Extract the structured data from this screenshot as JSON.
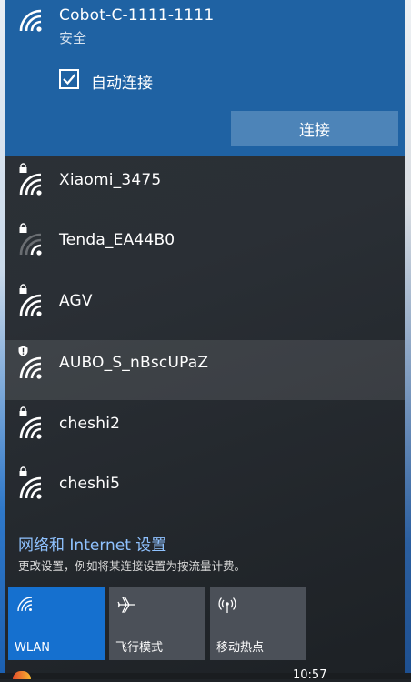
{
  "connected_network": {
    "name": "Cobot-C-1111-1111",
    "status": "安全",
    "auto_connect_label": "自动连接",
    "auto_connect_checked": true,
    "connect_button": "连接"
  },
  "networks": [
    {
      "name": "Xiaomi_3475",
      "secured": true,
      "badge": "lock-icon",
      "signal": 4
    },
    {
      "name": "Tenda_EA44B0",
      "secured": true,
      "badge": "lock-icon",
      "signal": 2
    },
    {
      "name": "AGV",
      "secured": true,
      "badge": "lock-icon",
      "signal": 4
    },
    {
      "name": "AUBO_S_nBscUPaZ",
      "secured": false,
      "badge": "shield-warning-icon",
      "signal": 4,
      "highlighted": true
    },
    {
      "name": "cheshi2",
      "secured": true,
      "badge": "lock-icon",
      "signal": 4
    },
    {
      "name": "cheshi5",
      "secured": true,
      "badge": "lock-icon",
      "signal": 4
    }
  ],
  "settings": {
    "link": "网络和 Internet 设置",
    "description": "更改设置，例如将某连接设置为按流量计费。"
  },
  "quick_actions": [
    {
      "label": "WLAN",
      "icon": "wifi-icon",
      "active": true
    },
    {
      "label": "飞行模式",
      "icon": "airplane-icon",
      "active": false
    },
    {
      "label": "移动热点",
      "icon": "hotspot-icon",
      "active": false
    }
  ],
  "taskbar": {
    "time": "10:57"
  },
  "colors": {
    "accent": "#1f62a3",
    "tile_active": "#1570cf",
    "link": "#8fc2ff",
    "panel": "#2c3136"
  }
}
